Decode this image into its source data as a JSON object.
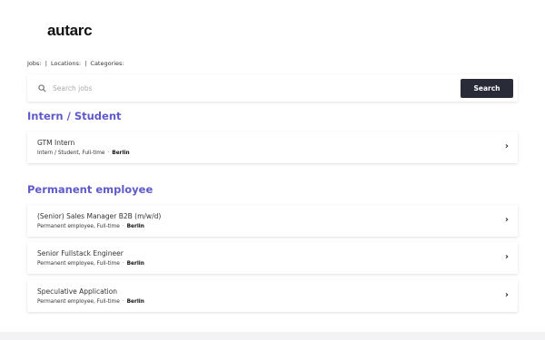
{
  "brand": {
    "logo_text": "autarc"
  },
  "filters": {
    "jobs": "Jobs:",
    "locations": "Locations:",
    "categories": "Categories:",
    "separator": "|"
  },
  "search": {
    "placeholder": "Search jobs",
    "button_label": "Search",
    "icon": "search-icon"
  },
  "sections": [
    {
      "title": "Intern / Student",
      "jobs": [
        {
          "title": "GTM Intern",
          "meta": "Intern / Student, Full-time",
          "city": "Berlin"
        }
      ]
    },
    {
      "title": "Permanent employee",
      "jobs": [
        {
          "title": "(Senior) Sales Manager B2B (m/w/d)",
          "meta": "Permanent employee, Full-time",
          "city": "Berlin"
        },
        {
          "title": "Senior Fullstack Engineer",
          "meta": "Permanent employee, Full-time",
          "city": "Berlin"
        },
        {
          "title": "Speculative Application",
          "meta": "Permanent employee, Full-time",
          "city": "Berlin"
        }
      ]
    }
  ],
  "meta_dot": "·",
  "chevron": "›",
  "colors": {
    "accent": "#5f5ac9",
    "button": "#2a2b38"
  }
}
